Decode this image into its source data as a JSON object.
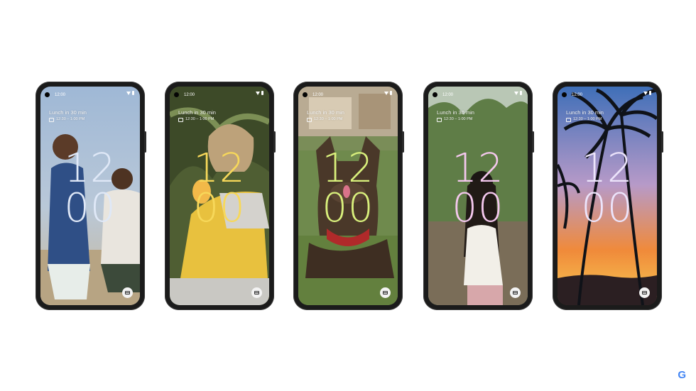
{
  "phones": [
    {
      "status_time": "12:00",
      "event_title": "Lunch in 30 min",
      "event_time": "12:30 – 1:00 PM",
      "clock_hours": "12",
      "clock_minutes": "00",
      "clock_color": "#dfe8f7",
      "wallpaper": "two boys playing on a beach",
      "widget_icon": "wallet-icon"
    },
    {
      "status_time": "12:00",
      "event_title": "Lunch in 30 min",
      "event_time": "12:30 – 1:00 PM",
      "clock_hours": "12",
      "clock_minutes": "00",
      "clock_color": "#f7d85a",
      "wallpaper": "child in yellow sweater eating",
      "widget_icon": "wallet-icon"
    },
    {
      "status_time": "12:00",
      "event_title": "Lunch in 30 min",
      "event_time": "12:30 – 1:00 PM",
      "clock_hours": "12",
      "clock_minutes": "00",
      "clock_color": "#d9f07c",
      "wallpaper": "french bulldog in grass with red bandana",
      "widget_icon": "wallet-icon"
    },
    {
      "status_time": "12:00",
      "event_title": "Lunch in 30 min",
      "event_time": "12:30 – 1:00 PM",
      "clock_hours": "12",
      "clock_minutes": "00",
      "clock_color": "#f4c8ee",
      "wallpaper": "woman with long hair from behind",
      "widget_icon": "wallet-icon"
    },
    {
      "status_time": "12:00",
      "event_title": "Lunch in 30 min",
      "event_time": "12:30 – 1:00 PM",
      "clock_hours": "12",
      "clock_minutes": "00",
      "clock_color": "#ece4fb",
      "wallpaper": "palm trees at sunset",
      "widget_icon": "wallet-icon"
    }
  ],
  "brand": {
    "logo": "G",
    "logo_colors": [
      "#4285f4",
      "#ea4335",
      "#fbbc05",
      "#34a853"
    ]
  }
}
